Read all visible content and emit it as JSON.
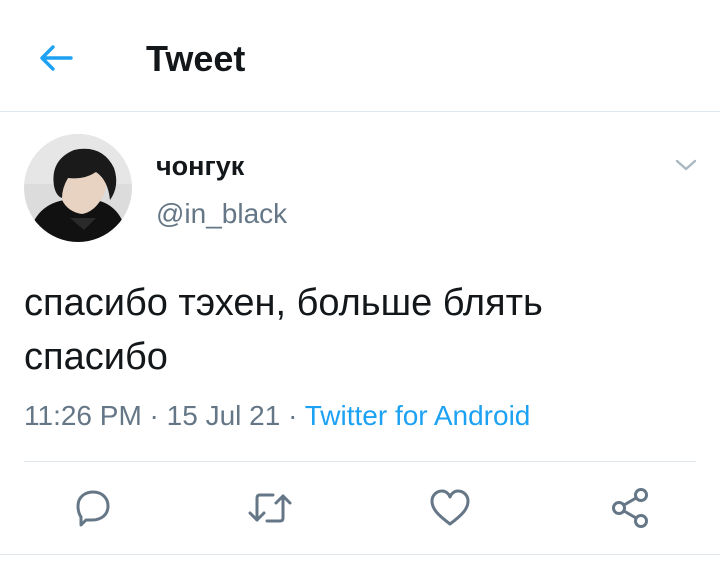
{
  "header": {
    "title": "Tweet",
    "back_icon": "back-arrow-icon"
  },
  "tweet": {
    "display_name": "чонгук",
    "handle": "@in_black",
    "text": "спасибо тэхен, больше блять спасибо",
    "time": "11:26 PM",
    "separator1": " · ",
    "date": "15 Jul 21",
    "separator2": " · ",
    "source": "Twitter for Android"
  },
  "actions": {
    "icons": [
      "reply-icon",
      "retweet-icon",
      "like-icon",
      "share-icon"
    ]
  },
  "colors": {
    "accent": "#1da1f2",
    "secondary_text": "#657786",
    "icon": "#657786",
    "divider": "#e1e8ed"
  }
}
